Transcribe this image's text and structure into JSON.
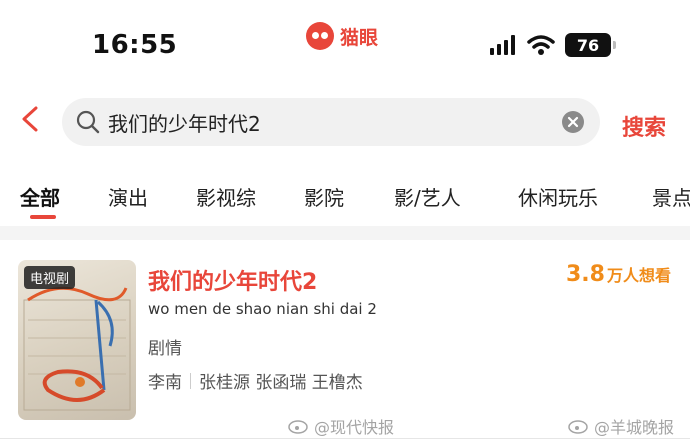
{
  "status_bar": {
    "time": "16:55",
    "app_name": "猫眼",
    "battery": "76",
    "icons": [
      "signal-icon",
      "wifi-icon",
      "battery-icon"
    ]
  },
  "search": {
    "query": "我们的少年时代2",
    "button_label": "搜索",
    "icons": [
      "back-icon",
      "search-icon",
      "clear-icon"
    ]
  },
  "tabs": [
    {
      "label": "全部",
      "active": true
    },
    {
      "label": "演出"
    },
    {
      "label": "影视综"
    },
    {
      "label": "影院"
    },
    {
      "label": "影/艺人"
    },
    {
      "label": "休闲玩乐"
    },
    {
      "label": "景点"
    }
  ],
  "result": {
    "badge": "电视剧",
    "title": "我们的少年时代2",
    "pinyin": "wo men de shao nian shi dai 2",
    "genre": "剧情",
    "director": "李南",
    "cast": "张桂源 张函瑞 王橹杰",
    "want_count": "3.8",
    "want_label": "万人想看"
  },
  "watermarks": [
    "@现代快报",
    "@羊城晚报"
  ],
  "colors": {
    "accent": "#e8463a",
    "want": "#f08c1a"
  }
}
